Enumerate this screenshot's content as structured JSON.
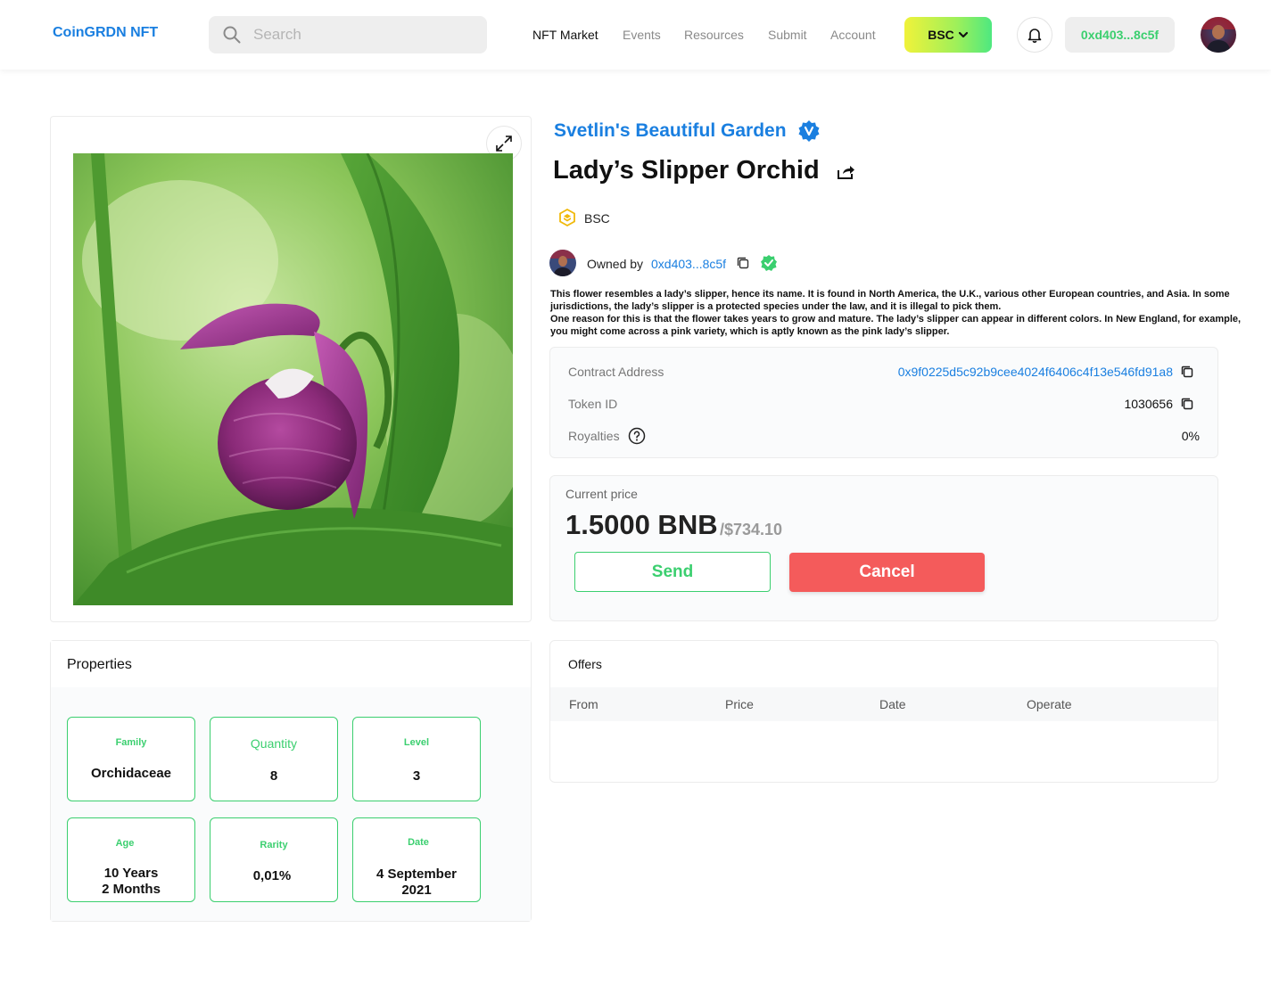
{
  "header": {
    "logo": "CoinGRDN NFT",
    "search_placeholder": "Search",
    "nav": [
      "NFT Market",
      "Events",
      "Resources",
      "Submit",
      "Account"
    ],
    "chain_button": "BSC",
    "wallet": "0xd403...8c5f",
    "colors": {
      "brand": "#1a7fe0",
      "accent_green": "#3bcf6f"
    }
  },
  "nft": {
    "collection": "Svetlin's Beautiful Garden",
    "title": "Lady’s Slipper Orchid",
    "chain": "BSC",
    "owner_label": "Owned by",
    "owner_address": "0xd403...8c5f",
    "description": [
      "This flower resembles a lady’s slipper, hence its name. It is found in North America, the U.K., various other European countries, and Asia. In some jurisdictions, the lady’s slipper is a protected species under the law, and it is illegal to pick them.",
      "One reason for this is that the flower takes years to grow and mature. The lady’s slipper can appear in different colors. In New England, for example, you might come across a pink variety, which is aptly known as the pink lady’s slipper."
    ]
  },
  "contract": {
    "address_label": "Contract Address",
    "address": "0x9f0225d5c92b9cee4024f6406c4f13e546fd91a8",
    "token_label": "Token ID",
    "token_id": "1030656",
    "royalties_label": "Royalties",
    "royalties": "0%"
  },
  "price": {
    "label": "Current price",
    "value": "1.5000 BNB",
    "usd": "/$734.10",
    "send_label": "Send",
    "cancel_label": "Cancel"
  },
  "properties": {
    "title": "Properties",
    "items": [
      {
        "name": "Family",
        "value": "Orchidaceae"
      },
      {
        "name": "Quantity",
        "value": "8"
      },
      {
        "name": "Level",
        "value": "3"
      },
      {
        "name": "Age",
        "value": "10 Years\n2 Months"
      },
      {
        "name": "Rarity",
        "value": "0,01%"
      },
      {
        "name": "Date",
        "value": "4 September\n2021"
      }
    ]
  },
  "offers": {
    "title": "Offers",
    "columns": [
      "From",
      "Price",
      "Date",
      "Operate"
    ]
  },
  "icons": {
    "search": "search-icon",
    "bell": "bell-icon",
    "expand": "expand-icon",
    "verified": "verified-badge-icon",
    "share": "share-icon",
    "copy": "copy-icon",
    "help": "help-icon",
    "chain": "bnb-chain-icon",
    "check": "check-circle-icon"
  }
}
